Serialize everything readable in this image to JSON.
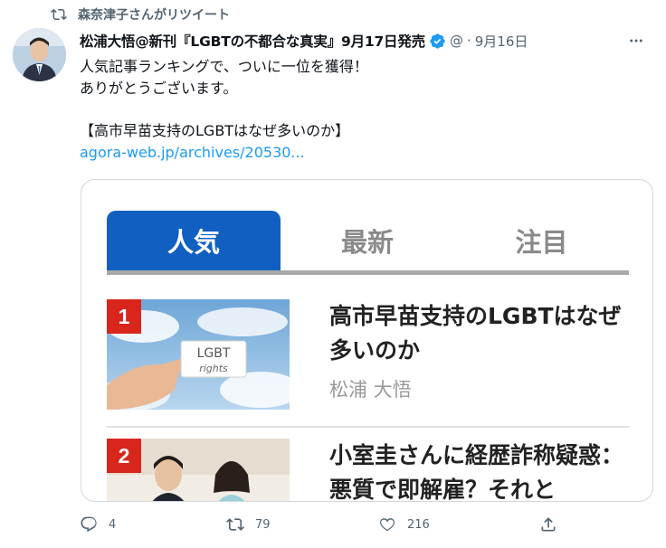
{
  "retweet_banner": "森奈津子さんがリツイート",
  "tweet": {
    "author_name": "松浦大悟@新刊『LGBTの不都合な真実』9月17日発売",
    "handle": "@",
    "separator": "·",
    "date": "9月16日",
    "text_line_1": "人気記事ランキングで、ついに一位を獲得！",
    "text_line_2": "ありがとうございます。",
    "text_line_3": "【高市早苗支持のLGBTはなぜ多いのか】",
    "link": "agora-web.jp/archives/20530..."
  },
  "card": {
    "tabs": [
      "人気",
      "最新",
      "注目"
    ],
    "articles": [
      {
        "rank": "1",
        "title": "高市早苗支持のLGBTはなぜ多いのか",
        "author": "松浦 大悟",
        "thumb_text_1": "LGBT",
        "thumb_text_2": "rights"
      },
      {
        "rank": "2",
        "title": "小室圭さんに経歴詐称疑惑：悪質で即解雇？それと"
      }
    ]
  },
  "actions": {
    "replies": "4",
    "retweets": "79",
    "likes": "216"
  },
  "colors": {
    "tab_active": "#1160c1",
    "rank_badge": "#d9261c",
    "link": "#1d9bf0",
    "verified": "#1d9bf0"
  }
}
